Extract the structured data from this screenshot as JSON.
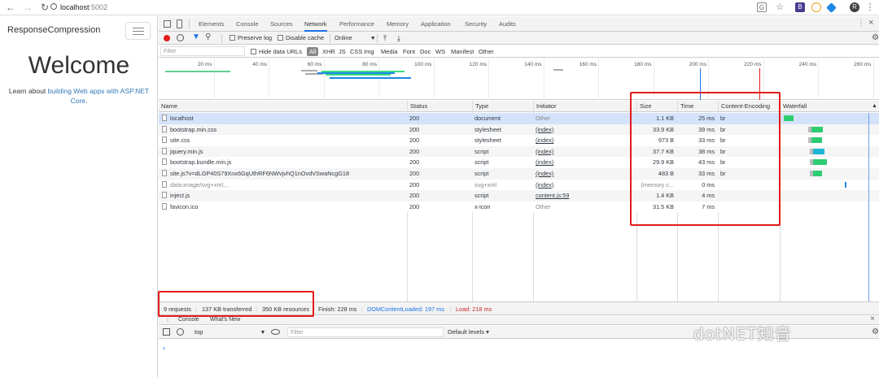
{
  "browser": {
    "url_host": "localhost",
    "url_port": ":5002",
    "extensions": [
      "translate-icon",
      "star-icon",
      "B",
      "O",
      "tag-icon",
      "avatar"
    ]
  },
  "page": {
    "brand": "ResponseCompression",
    "welcome": "Welcome",
    "lead_prefix": "Learn about ",
    "lead_link": "building Web apps with ASP.NET Core",
    "lead_suffix": "."
  },
  "devtools": {
    "tabs": [
      "Elements",
      "Console",
      "Sources",
      "Network",
      "Performance",
      "Memory",
      "Application",
      "Security",
      "Audits"
    ],
    "selected_tab": "Network",
    "toolbar": {
      "preserve_log": "Preserve log",
      "disable_cache": "Disable cache",
      "throttle": "Online"
    },
    "filter_placeholder": "Filter",
    "hide_data_urls": "Hide data URLs",
    "filter_types": [
      "All",
      "XHR",
      "JS",
      "CSS",
      "Img",
      "Media",
      "Font",
      "Doc",
      "WS",
      "Manifest",
      "Other"
    ],
    "ruler": [
      "20 ms",
      "40 ms",
      "60 ms",
      "80 ms",
      "100 ms",
      "120 ms",
      "140 ms",
      "160 ms",
      "180 ms",
      "200 ms",
      "220 ms",
      "240 ms",
      "260 ms"
    ],
    "columns": [
      "Name",
      "Status",
      "Type",
      "Initiator",
      "Size",
      "Time",
      "Content-Encoding",
      "Waterfall"
    ],
    "rows": [
      {
        "name": "localhost",
        "status": "200",
        "type": "document",
        "initiator": "Other",
        "size": "1.1 KB",
        "time": "25 ms",
        "enc": "br",
        "gray": false,
        "link": false
      },
      {
        "name": "bootstrap.min.css",
        "status": "200",
        "type": "stylesheet",
        "initiator": "(index)",
        "size": "33.9 KB",
        "time": "39 ms",
        "enc": "br",
        "gray": false,
        "link": true
      },
      {
        "name": "site.css",
        "status": "200",
        "type": "stylesheet",
        "initiator": "(index)",
        "size": "973 B",
        "time": "33 ms",
        "enc": "br",
        "gray": false,
        "link": true
      },
      {
        "name": "jquery.min.js",
        "status": "200",
        "type": "script",
        "initiator": "(index)",
        "size": "37.7 KB",
        "time": "38 ms",
        "enc": "br",
        "gray": false,
        "link": true
      },
      {
        "name": "bootstrap.bundle.min.js",
        "status": "200",
        "type": "script",
        "initiator": "(index)",
        "size": "29.9 KB",
        "time": "43 ms",
        "enc": "br",
        "gray": false,
        "link": true
      },
      {
        "name": "site.js?v=dLGP40S79Xnx6GqUthRF6NWvjvhQ1nOvdVSwaNcgG18",
        "status": "200",
        "type": "script",
        "initiator": "(index)",
        "size": "483 B",
        "time": "33 ms",
        "enc": "br",
        "gray": false,
        "link": true
      },
      {
        "name": "data:image/svg+xml,...",
        "status": "200",
        "type": "svg+xml",
        "initiator": "(index)",
        "size": "(memory c...",
        "time": "0 ms",
        "enc": "",
        "gray": true,
        "link": true
      },
      {
        "name": "inject.js",
        "status": "200",
        "type": "script",
        "initiator": "content.js:59",
        "size": "1.4 KB",
        "time": "4 ms",
        "enc": "",
        "gray": false,
        "link": true
      },
      {
        "name": "favicon.ico",
        "status": "200",
        "type": "x-icon",
        "initiator": "Other",
        "size": "31.5 KB",
        "time": "7 ms",
        "enc": "",
        "gray": false,
        "link": false
      }
    ],
    "summary": {
      "requests": "9 requests",
      "transferred": "137 KB transferred",
      "resources": "350 KB resources",
      "finish": "Finish: 228 ms",
      "dcl": "DOMContentLoaded: 197 ms",
      "load": "Load: 218 ms"
    },
    "drawer": {
      "tabs": [
        "Console",
        "What's New"
      ],
      "context": "top",
      "filter_placeholder": "Filter",
      "levels": "Default levels ▾",
      "prompt": "›"
    }
  },
  "watermark": "dotNET知音",
  "colors": {
    "highlight": "#e21b1b",
    "accent": "#1a73e8",
    "link": "#337ab7"
  }
}
